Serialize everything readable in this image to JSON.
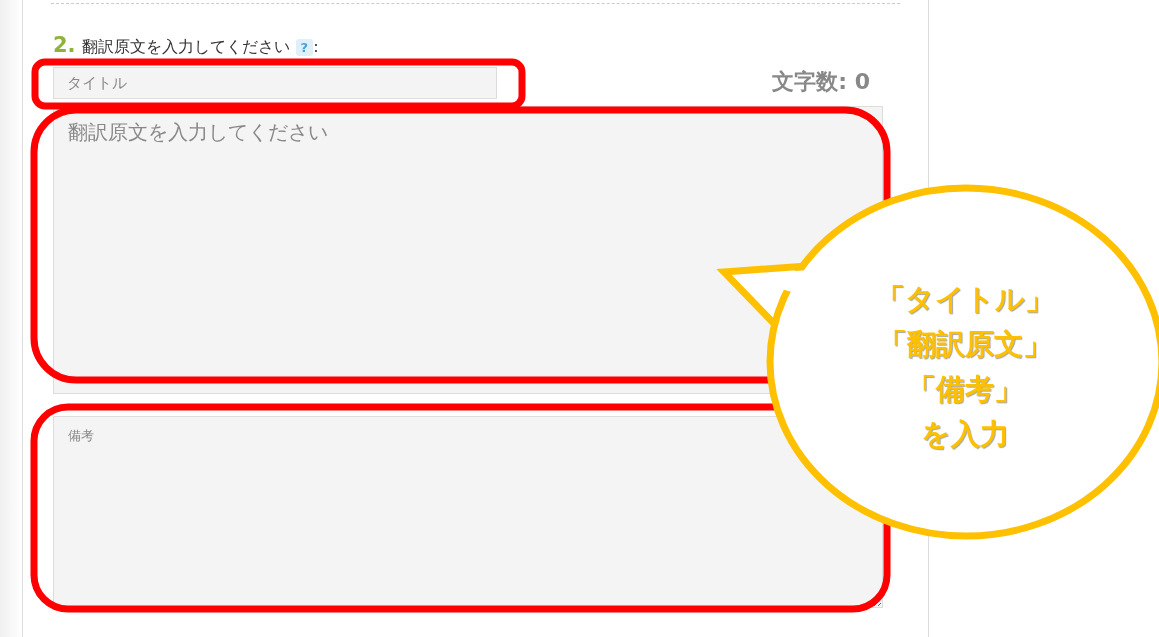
{
  "section": {
    "number": "2.",
    "label": "翻訳原文を入力してください",
    "help": "?",
    "colon": ":"
  },
  "title_field": {
    "placeholder": "タイトル"
  },
  "char_count": "文字数: 0",
  "source_field": {
    "placeholder": "翻訳原文を入力してください"
  },
  "memo_field": {
    "placeholder": "備考"
  },
  "callout": {
    "lines": [
      "「タイトル」",
      "「翻訳原文」",
      "「備考」",
      "を入力"
    ]
  }
}
